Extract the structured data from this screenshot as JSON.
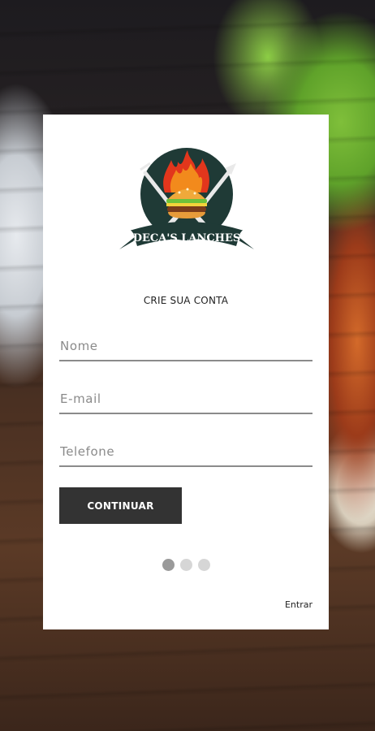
{
  "logo": {
    "text": "DECA'S LANCHES"
  },
  "form": {
    "title": "CRIE SUA CONTA",
    "fields": [
      {
        "placeholder": "Nome",
        "value": ""
      },
      {
        "placeholder": "E-mail",
        "value": ""
      },
      {
        "placeholder": "Telefone",
        "value": ""
      }
    ],
    "continue_label": "CONTINUAR"
  },
  "pager": {
    "count": 3,
    "active_index": 0
  },
  "login_link": "Entrar",
  "colors": {
    "button_bg": "#333333",
    "card_bg": "#ffffff",
    "dot_active": "#9a9a9a",
    "dot_inactive": "#d6d6d6"
  }
}
